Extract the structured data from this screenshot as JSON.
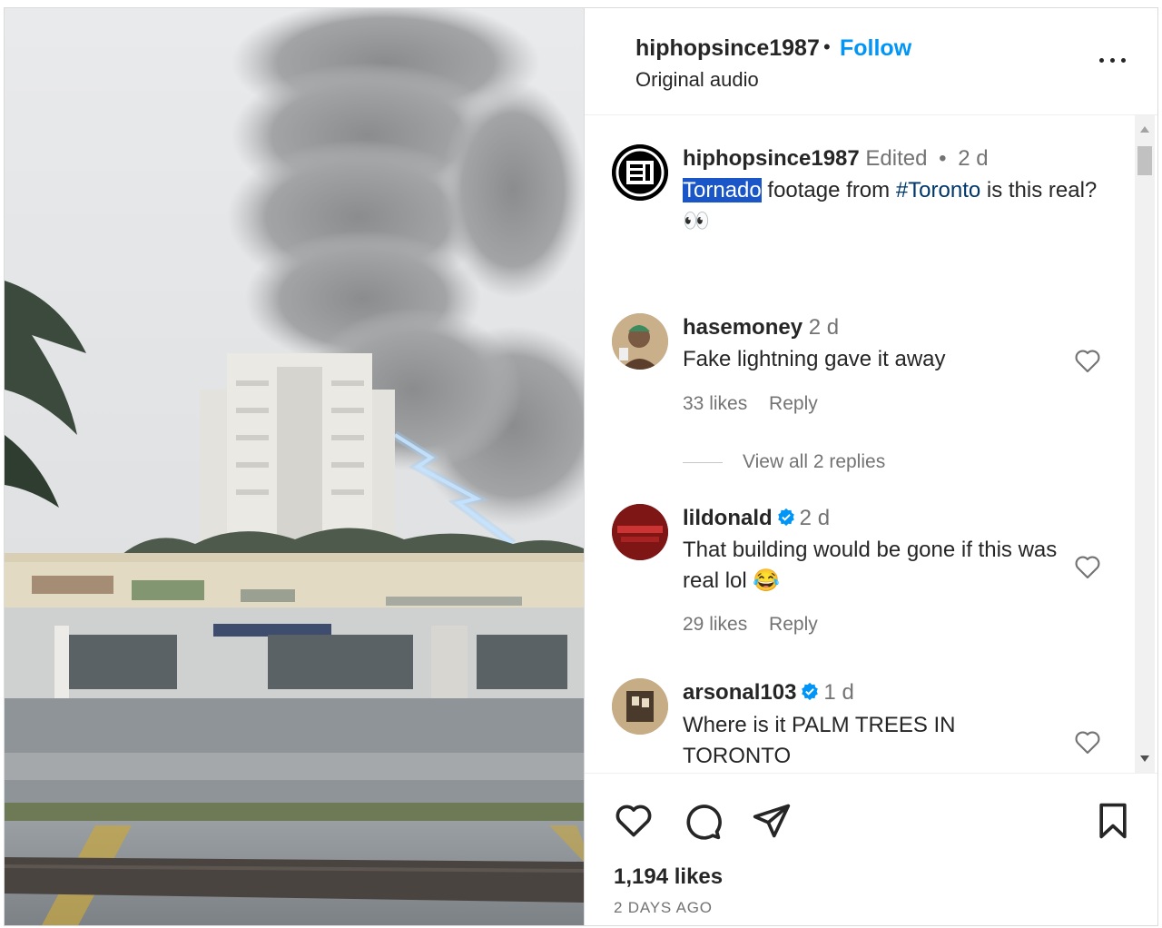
{
  "post": {
    "username": "hiphopsince1987",
    "separator": "•",
    "follow_label": "Follow",
    "audio": "Original audio"
  },
  "caption": {
    "username": "hiphopsince1987",
    "edited": "Edited",
    "dot": "•",
    "time": "2 d",
    "highlighted_word": "Tornado",
    "text_part": " footage from ",
    "hashtag": "#Toronto",
    "text_end": " is this real?👀"
  },
  "comments": [
    {
      "username": "hasemoney",
      "verified": false,
      "time": "2 d",
      "text": "Fake lightning gave it away",
      "likes": "33 likes",
      "reply": "Reply",
      "view_replies": "View all 2 replies"
    },
    {
      "username": "lildonald",
      "verified": true,
      "time": "2 d",
      "text": "That building would be gone if this was real lol 😂",
      "likes": "29 likes",
      "reply": "Reply"
    },
    {
      "username": "arsonal103",
      "verified": true,
      "time": "1 d",
      "text": "Where is it PALM TREES IN TORONTO"
    }
  ],
  "footer": {
    "likes": "1,194 likes",
    "posted": "2 DAYS AGO"
  },
  "icons": {
    "like": "heart-icon",
    "comment": "comment-icon",
    "share": "share-icon",
    "save": "bookmark-icon",
    "more": "more-icon",
    "verified": "verified-badge-icon"
  },
  "colors": {
    "accent": "#0095f6",
    "verified": "#0095f6",
    "highlight": "#1a56c8",
    "hashtag": "#00376b",
    "muted": "#737373"
  }
}
